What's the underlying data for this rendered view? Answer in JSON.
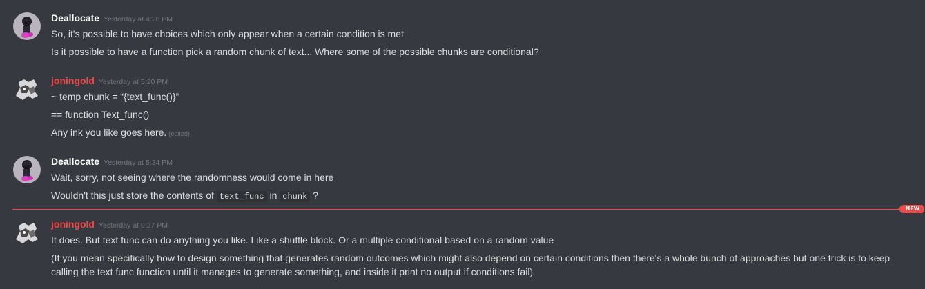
{
  "messages": [
    {
      "author": "Deallocate",
      "timestamp": "Yesterday at 4:26 PM",
      "lines": [
        "So, it's possible to have choices which only appear when a certain condition is met",
        "Is it possible to have a function pick a random chunk of text... Where some of the possible chunks are conditional?"
      ]
    },
    {
      "author": "joningold",
      "timestamp": "Yesterday at 5:20 PM",
      "lines": [
        "~ temp chunk = “{text_func()}”",
        "== function Text_func()",
        "Any ink you like goes here."
      ],
      "edited": "(edited)"
    },
    {
      "author": "Deallocate",
      "timestamp": "Yesterday at 5:34 PM",
      "lines": [
        "Wait, sorry, not seeing where the randomness would come in here"
      ],
      "line2": {
        "prefix": "Wouldn't this just store the contents of ",
        "code1": "text_func",
        "middle": " in ",
        "code2": "chunk",
        "suffix": " ?"
      }
    },
    {
      "author": "joningold",
      "timestamp": "Yesterday at 9:27 PM",
      "lines": [
        "It does. But text func can do anything you like. Like a shuffle block. Or a multiple conditional based on a random value",
        "(If you mean specifically how to design something that generates random outcomes which might also depend on certain conditions then there's a whole bunch of approaches but one trick is to keep calling the text func function until it manages to generate something, and inside it print no output if  conditions fail)"
      ]
    }
  ],
  "divider": {
    "badge": "NEW"
  },
  "colors": {
    "background": "#36393f",
    "username_default": "#ffffff",
    "username_red": "#f04747",
    "text": "#dcddde",
    "timestamp": "#72767d",
    "new_divider": "#f04747"
  }
}
